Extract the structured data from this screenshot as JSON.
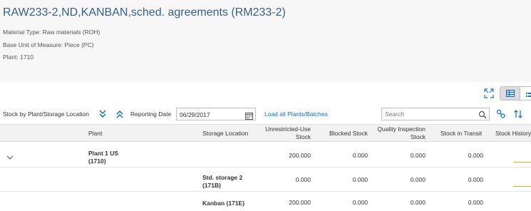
{
  "header": {
    "title": "RAW233-2,ND,KANBAN,sched. agreements (RM233-2)",
    "attributes": [
      "Material Type: Raw materials (ROH)",
      "Base Unit of Measure: Piece (PC)",
      "Plant: 1710"
    ]
  },
  "viewbar": {
    "icons": [
      "fullscreen-icon",
      "grid-view-icon",
      "list-view-icon"
    ]
  },
  "toolbar": {
    "title": "Stock by Plant/Storage Location",
    "reporting_label": "Reporting Date",
    "reporting_date": "06/29/2017",
    "load_all_label": "Load all Plants/Batches",
    "search_placeholder": "Search"
  },
  "table": {
    "columns": {
      "plant": "Plant",
      "storage": "Storage Location",
      "unrestricted_1": "Unrestricted-Use",
      "unrestricted_2": "Stock",
      "blocked": "Blocked Stock",
      "quality_1": "Quality Inspection",
      "quality_2": "Stock",
      "transit": "Stock in Transit",
      "history": "Stock History"
    },
    "rows": [
      {
        "plant_1": "Plant 1 US",
        "plant_2": "(1710)",
        "storage_1": "",
        "storage_2": "",
        "unrestricted": "200.000",
        "blocked": "0.000",
        "quality": "0.000",
        "transit": "0.000"
      },
      {
        "plant_1": "",
        "plant_2": "",
        "storage_1": "Std. storage 2",
        "storage_2": "(171B)",
        "unrestricted": "0.000",
        "blocked": "0.000",
        "quality": "0.000",
        "transit": "0.000"
      },
      {
        "plant_1": "",
        "plant_2": "",
        "storage_1": "Kanban (171E)",
        "storage_2": "",
        "unrestricted": "200.000",
        "blocked": "0.000",
        "quality": "0.000",
        "transit": "0.000"
      }
    ]
  },
  "colors": {
    "title": "#346187",
    "link": "#0a6ed1",
    "accent": "#0a6ed1",
    "history_line": "#e8b100"
  }
}
